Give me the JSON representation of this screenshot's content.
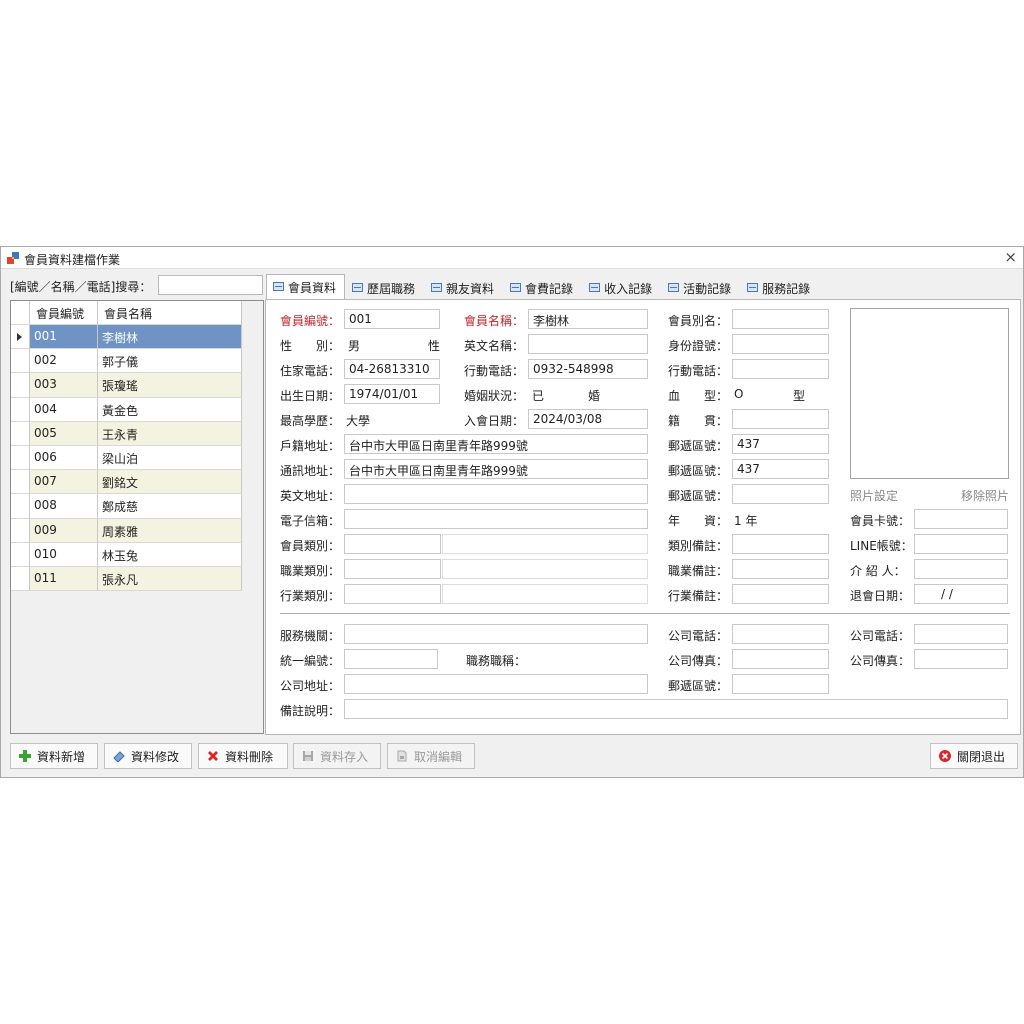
{
  "window": {
    "title": "會員資料建檔作業",
    "close_glyph": "×"
  },
  "search": {
    "label": "[編號／名稱／電話]搜尋：",
    "value": ""
  },
  "grid": {
    "headers": [
      "會員編號",
      "會員名稱"
    ],
    "rows": [
      {
        "id": "001",
        "name": "李樹林"
      },
      {
        "id": "002",
        "name": "郭子儀"
      },
      {
        "id": "003",
        "name": "張瓊瑤"
      },
      {
        "id": "004",
        "name": "黃金色"
      },
      {
        "id": "005",
        "name": "王永青"
      },
      {
        "id": "006",
        "name": "梁山泊"
      },
      {
        "id": "007",
        "name": "劉銘文"
      },
      {
        "id": "008",
        "name": "鄭成慈"
      },
      {
        "id": "009",
        "name": "周素雅"
      },
      {
        "id": "010",
        "name": "林玉兔"
      },
      {
        "id": "011",
        "name": "張永凡"
      }
    ],
    "selected_index": 0
  },
  "tabs": [
    "會員資料",
    "歷屆職務",
    "親友資料",
    "會費記錄",
    "收入記錄",
    "活動記錄",
    "服務記錄"
  ],
  "active_tab": 0,
  "form": {
    "labels": {
      "member_no": "會員編號：",
      "member_name": "會員名稱：",
      "alias": "會員別名：",
      "gender": "性　　別：",
      "eng_name": "英文名稱：",
      "id_no": "身份證號：",
      "home_phone": "住家電話：",
      "mobile": "行動電話：",
      "mobile2": "行動電話：",
      "birth": "出生日期：",
      "marital": "婚姻狀況：",
      "blood": "血　　型：",
      "education": "最高學歷：",
      "join_date": "入會日期：",
      "native": "籍　　貫：",
      "reg_addr": "戶籍地址：",
      "zip1": "郵遞區號：",
      "mail_addr": "通訊地址：",
      "zip2": "郵遞區號：",
      "eng_addr": "英文地址：",
      "zip3": "郵遞區號：",
      "email": "電子信箱：",
      "seniority": "年　　資：",
      "member_type": "會員類別：",
      "type_note": "類別備註：",
      "job_type": "職業類別：",
      "job_note": "職業備註：",
      "industry": "行業類別：",
      "industry_note": "行業備註：",
      "card_no": "會員卡號：",
      "line_id": "LINE帳號：",
      "referrer": "介 紹 人：",
      "quit_date": "退會日期：",
      "org": "服務機關：",
      "co_phone": "公司電話：",
      "co_phone2": "公司電話：",
      "tax_id": "統一編號：",
      "job_title": "職務職稱：",
      "co_fax": "公司傳真：",
      "co_fax2": "公司傳真：",
      "co_addr": "公司地址：",
      "zip4": "郵遞區號：",
      "remark": "備註說明："
    },
    "values": {
      "member_no": "001",
      "member_name": "李樹林",
      "gender_left": "男",
      "gender_right": "性",
      "home_phone": "04-26813310",
      "mobile": "0932-548998",
      "birth": "1974/01/01",
      "marital_left": "已",
      "marital_right": "婚",
      "blood_left": "O",
      "blood_right": "型",
      "education": "大學",
      "join_date": "2024/03/08",
      "reg_addr": "台中市大甲區日南里青年路999號",
      "zip1": "437",
      "mail_addr": "台中市大甲區日南里青年路999號",
      "zip2": "437",
      "seniority": "1 年",
      "quit_date": "/  /"
    },
    "photo_set": "照片設定",
    "photo_remove": "移除照片"
  },
  "buttons": {
    "add": "資料新增",
    "edit": "資料修改",
    "delete": "資料刪除",
    "save": "資料存入",
    "cancel": "取消編輯",
    "close": "關閉退出"
  },
  "colors": {
    "accent_selected_row": "#6e93c4",
    "required_label": "#c0272d",
    "add_icon": "#3aa52f",
    "delete_icon": "#d9262c"
  }
}
